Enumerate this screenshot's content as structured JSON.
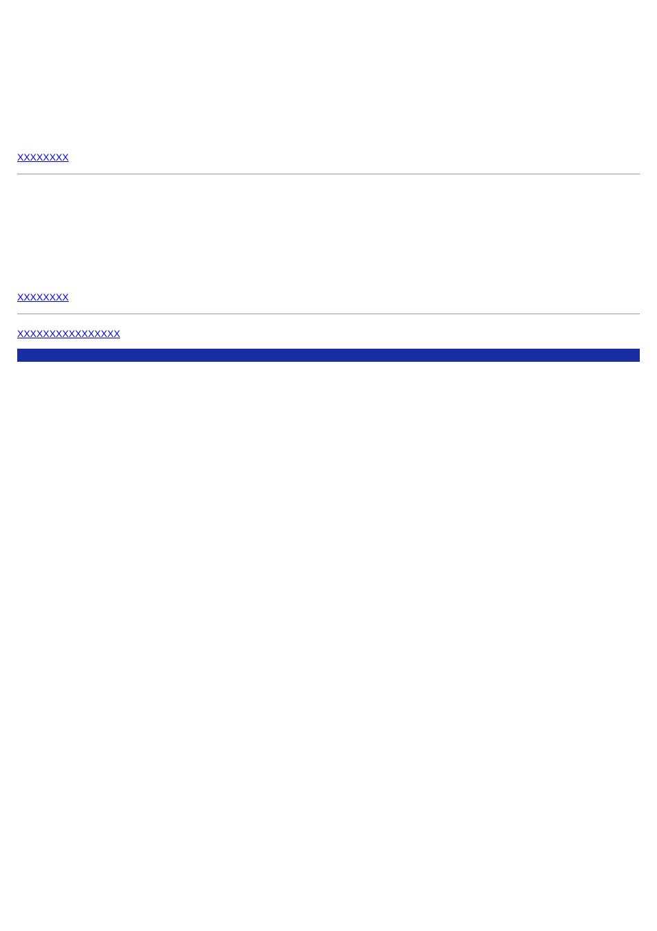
{
  "links": {
    "first": "XXXXXXXX",
    "second": "XXXXXXXX",
    "third": "XXXXXXXXXXXXXXXX"
  }
}
